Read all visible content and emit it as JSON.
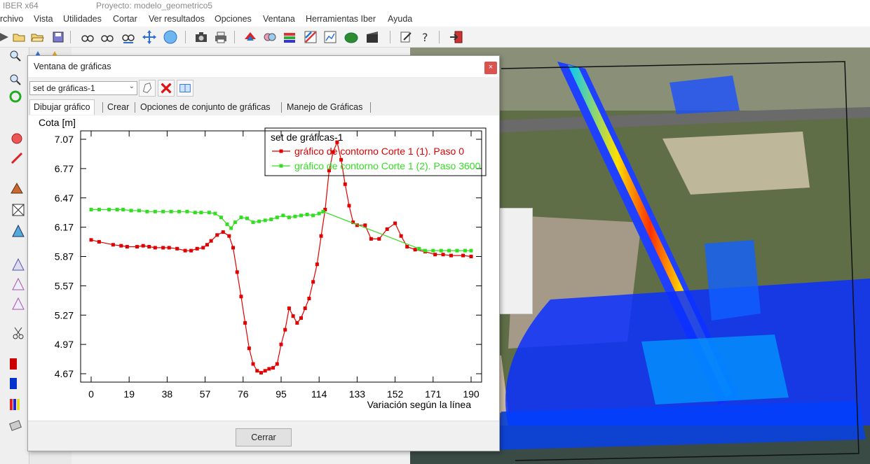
{
  "titlebar": {
    "app": "IBER x64",
    "project": "Proyecto: modelo_geometrico5"
  },
  "menu": [
    "rchivo",
    "Vista",
    "Utilidades",
    "Cortar",
    "Ver resultados",
    "Opciones",
    "Ventana",
    "Herramientas Iber",
    "Ayuda"
  ],
  "dialog": {
    "title": "Ventana de gráficas",
    "close_glyph": "×",
    "set_select_value": "set de gráficas-1",
    "tabs": [
      "Dibujar gráfico",
      "Crear",
      "Opciones de conjunto de gráficas",
      "Manejo de Gráficas"
    ],
    "close_button": "Cerrar"
  },
  "colors": {
    "series1": "#e00000",
    "series2": "#33dd22",
    "accent": "#d9534f"
  },
  "chart_data": {
    "type": "line",
    "ylabel": "Cota [m]",
    "xlabel": "Variación según la línea",
    "xlim": [
      0,
      190
    ],
    "ylim": [
      4.67,
      7.07
    ],
    "x_ticks": [
      0,
      19,
      38,
      57,
      76,
      95,
      114,
      133,
      152,
      171,
      190
    ],
    "y_ticks": [
      7.07,
      6.77,
      6.47,
      6.17,
      5.87,
      5.57,
      5.27,
      4.97,
      4.67
    ],
    "legend": {
      "title": "set de gráficas-1",
      "placement": "top-right"
    },
    "series": [
      {
        "name": "gráfico de contorno Corte 1 (1). Paso 0",
        "color": "#e00000",
        "points": [
          [
            0,
            6.04
          ],
          [
            4,
            6.02
          ],
          [
            11,
            5.99
          ],
          [
            15,
            5.98
          ],
          [
            18,
            5.97
          ],
          [
            23,
            5.97
          ],
          [
            26,
            5.98
          ],
          [
            29,
            5.97
          ],
          [
            32,
            5.96
          ],
          [
            36,
            5.96
          ],
          [
            39,
            5.96
          ],
          [
            43,
            5.95
          ],
          [
            47,
            5.93
          ],
          [
            50,
            5.93
          ],
          [
            53,
            5.95
          ],
          [
            56,
            5.96
          ],
          [
            58,
            5.99
          ],
          [
            60,
            6.03
          ],
          [
            63,
            6.09
          ],
          [
            66,
            6.12
          ],
          [
            69,
            6.08
          ],
          [
            71,
            5.96
          ],
          [
            73,
            5.71
          ],
          [
            75,
            5.46
          ],
          [
            77,
            5.19
          ],
          [
            79,
            4.93
          ],
          [
            81,
            4.77
          ],
          [
            83,
            4.7
          ],
          [
            85,
            4.68
          ],
          [
            87,
            4.7
          ],
          [
            89,
            4.72
          ],
          [
            91,
            4.73
          ],
          [
            93,
            4.77
          ],
          [
            95,
            4.97
          ],
          [
            97,
            5.12
          ],
          [
            99,
            5.34
          ],
          [
            101,
            5.26
          ],
          [
            103,
            5.19
          ],
          [
            105,
            5.24
          ],
          [
            107,
            5.34
          ],
          [
            109,
            5.44
          ],
          [
            111,
            5.61
          ],
          [
            113,
            5.79
          ],
          [
            115,
            6.08
          ],
          [
            117,
            6.35
          ],
          [
            119,
            6.75
          ],
          [
            121,
            6.94
          ],
          [
            123,
            7.04
          ],
          [
            125,
            6.86
          ],
          [
            127,
            6.61
          ],
          [
            129,
            6.39
          ],
          [
            131,
            6.22
          ],
          [
            133,
            6.19
          ],
          [
            137,
            6.19
          ],
          [
            140,
            6.05
          ],
          [
            144,
            6.05
          ],
          [
            148,
            6.15
          ],
          [
            152,
            6.21
          ],
          [
            155,
            6.08
          ],
          [
            158,
            5.97
          ],
          [
            162,
            5.94
          ],
          [
            167,
            5.92
          ],
          [
            172,
            5.89
          ],
          [
            176,
            5.89
          ],
          [
            180,
            5.88
          ],
          [
            186,
            5.88
          ],
          [
            190,
            5.87
          ]
        ]
      },
      {
        "name": "gráfico de contorno Corte 1 (2). Paso 3600",
        "color": "#33dd22",
        "points": [
          [
            0,
            6.35
          ],
          [
            4,
            6.35
          ],
          [
            9,
            6.35
          ],
          [
            13,
            6.35
          ],
          [
            16,
            6.35
          ],
          [
            20,
            6.34
          ],
          [
            24,
            6.34
          ],
          [
            28,
            6.33
          ],
          [
            32,
            6.33
          ],
          [
            36,
            6.33
          ],
          [
            40,
            6.33
          ],
          [
            44,
            6.33
          ],
          [
            48,
            6.33
          ],
          [
            52,
            6.32
          ],
          [
            55,
            6.32
          ],
          [
            59,
            6.32
          ],
          [
            62,
            6.31
          ],
          [
            65,
            6.27
          ],
          [
            68,
            6.2
          ],
          [
            70,
            6.16
          ],
          [
            72,
            6.22
          ],
          [
            75,
            6.27
          ],
          [
            78,
            6.26
          ],
          [
            81,
            6.22
          ],
          [
            84,
            6.23
          ],
          [
            87,
            6.24
          ],
          [
            90,
            6.25
          ],
          [
            93,
            6.27
          ],
          [
            96,
            6.29
          ],
          [
            99,
            6.27
          ],
          [
            102,
            6.28
          ],
          [
            105,
            6.29
          ],
          [
            108,
            6.3
          ],
          [
            111,
            6.29
          ],
          [
            114,
            6.31
          ],
          [
            116,
            6.33
          ],
          [
            164,
            5.95
          ],
          [
            167,
            5.93
          ],
          [
            171,
            5.93
          ],
          [
            175,
            5.93
          ],
          [
            179,
            5.93
          ],
          [
            183,
            5.93
          ],
          [
            187,
            5.93
          ],
          [
            190,
            5.93
          ]
        ]
      }
    ]
  }
}
